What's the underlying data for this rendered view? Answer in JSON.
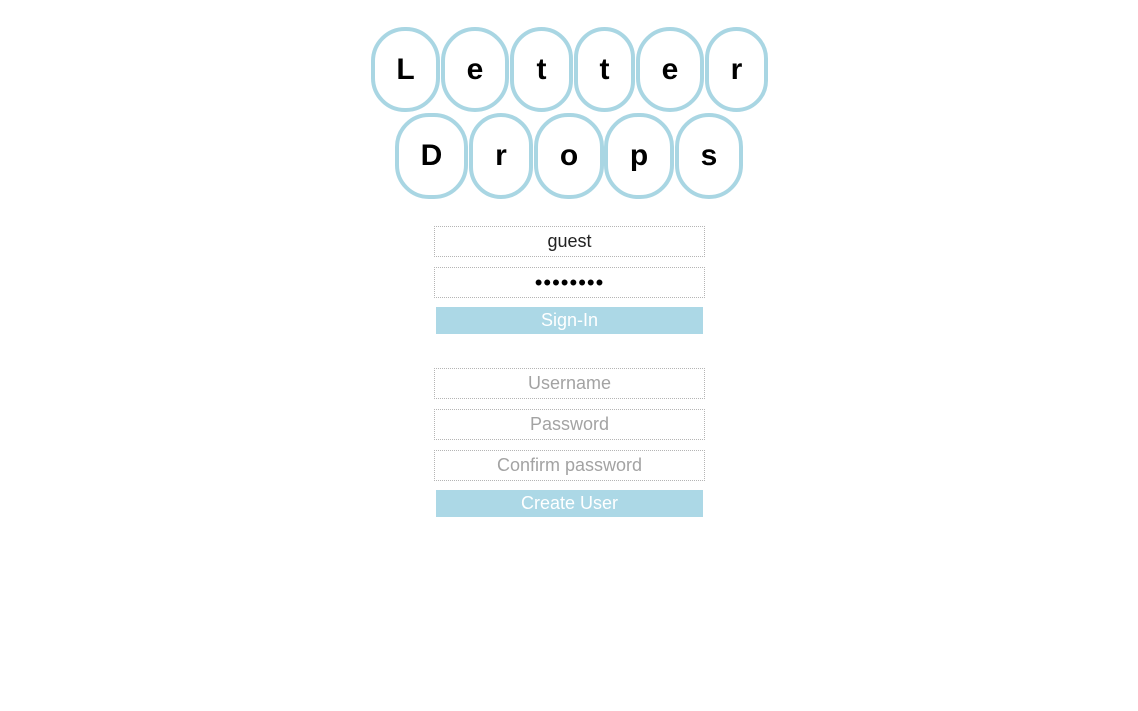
{
  "logo": {
    "row1": [
      "L",
      "e",
      "t",
      "t",
      "e",
      "r"
    ],
    "row2": [
      "D",
      "r",
      "o",
      "p",
      "s"
    ],
    "tile_border_color": "#a9d6e3"
  },
  "signin": {
    "username_value": "guest",
    "password_value": "••••••••",
    "button_label": "Sign-In"
  },
  "create": {
    "username_placeholder": "Username",
    "password_placeholder": "Password",
    "confirm_placeholder": "Confirm password",
    "button_label": "Create User"
  },
  "colors": {
    "button_bg": "#acd8e6",
    "button_text": "#ffffff"
  }
}
